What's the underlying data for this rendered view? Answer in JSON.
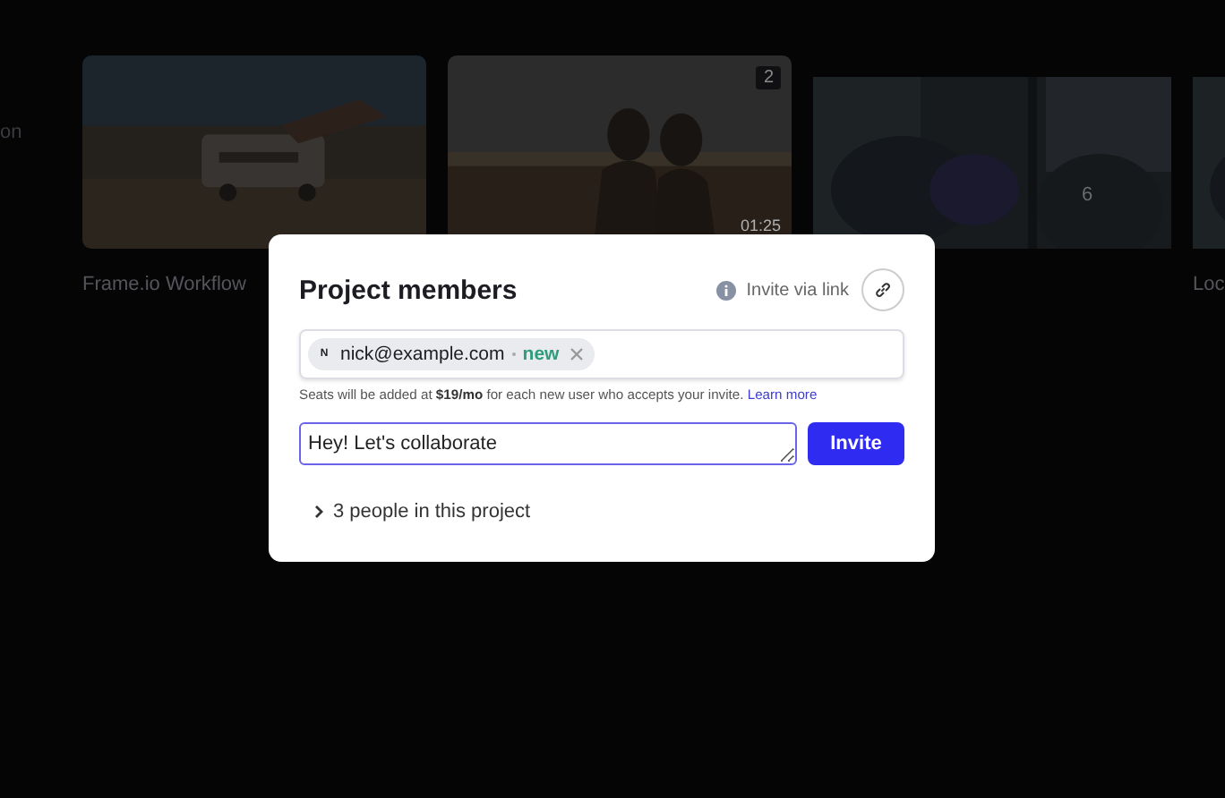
{
  "background": {
    "sidebar_text": "on",
    "cards": [
      {
        "kind": "beach",
        "title": "Frame.io Workflow"
      },
      {
        "kind": "couple",
        "count": "2",
        "duration": "01:25"
      },
      {
        "kind": "forest",
        "center_count": "6"
      },
      {
        "kind": "forest",
        "title": "Loc"
      }
    ]
  },
  "dialog": {
    "title": "Project members",
    "invite_link": {
      "label": "Invite via link"
    },
    "recipients": [
      {
        "initial": "N",
        "email": "nick@example.com",
        "tag": "new"
      }
    ],
    "note": "Seats will be added at **$19/mo** for each new user who accepts your invite.",
    "learn_more": "Learn more",
    "message": {
      "value": "Hey! Let's collaborate"
    },
    "invite_button": "Invite",
    "members_toggle": {
      "label": "3 people in this project",
      "expanded": false
    }
  }
}
